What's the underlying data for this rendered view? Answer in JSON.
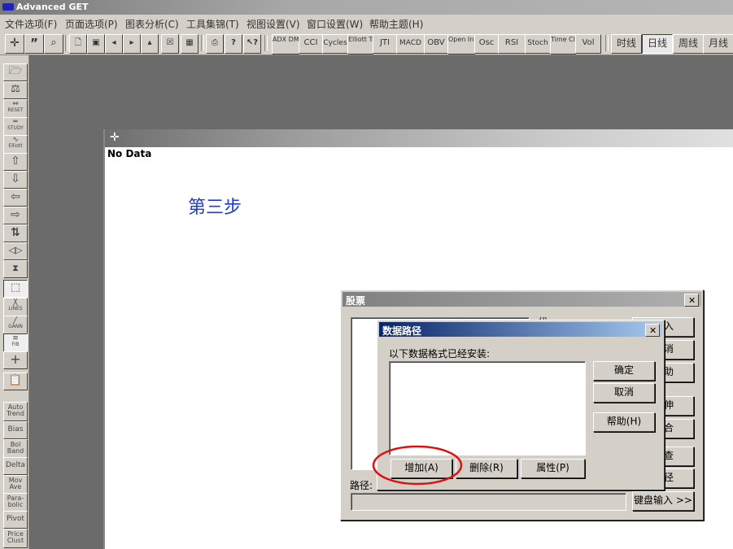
{
  "app": {
    "title": "Advanced GET"
  },
  "menu": [
    "文件选项(F)",
    "页面选项(P)",
    "图表分析(C)",
    "工具集锦(T)",
    "视图设置(V)",
    "窗口设置(W)",
    "帮助主题(H)"
  ],
  "toolbar": {
    "indicators": [
      "ADX DMI",
      "CCI",
      "Cycles",
      "Elliott Trng",
      "JTI",
      "MACD",
      "OBV",
      "Open Int",
      "Osc",
      "RSI",
      "Stoch",
      "Time Clust",
      "Vol"
    ],
    "periods": [
      "时线",
      "日线",
      "周线",
      "月线"
    ]
  },
  "lefttools": {
    "reset": "RESET",
    "study": "STUDY",
    "elliott": "Elliott",
    "lines": "LINES",
    "gann": "GANN",
    "fib": "FIB",
    "studies": [
      "Auto Trend",
      "Bias",
      "Bol Band",
      "Delta",
      "Mov Ave",
      "Para-bolic",
      "Pivot",
      "Price Clust"
    ]
  },
  "chart": {
    "status": "No Data",
    "annotation": "第三步"
  },
  "stock_dialog": {
    "title": "股票",
    "path_label": "路径:",
    "keyboard_button": "键盘输入 >>",
    "side_buttons": [
      "入",
      "消",
      "助",
      "延伸",
      "组合",
      "检查",
      "路径"
    ],
    "frag_label": "代"
  },
  "path_dialog": {
    "title": "数据路径",
    "caption": "以下数据格式已经安装:",
    "ok": "确定",
    "cancel": "取消",
    "help": "帮助(H)",
    "add": "增加(A)",
    "delete": "删除(R)",
    "properties": "属性(P)"
  },
  "colors": {
    "annotation": "#1a3ad6",
    "highlight": "#e01010",
    "dialog_title": "#0a246a"
  }
}
